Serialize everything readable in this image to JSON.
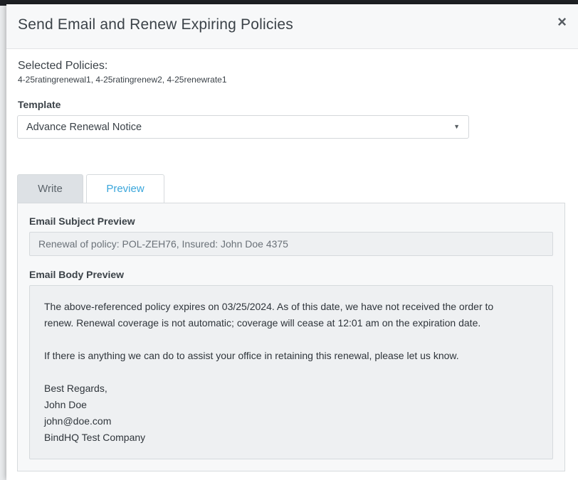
{
  "modal": {
    "title": "Send Email and Renew Expiring Policies",
    "close_label": "×"
  },
  "selected": {
    "label": "Selected Policies:",
    "values": "4-25ratingrenewal1, 4-25ratingrenew2, 4-25renewrate1"
  },
  "template": {
    "label": "Template",
    "selected_value": "Advance Renewal Notice",
    "caret": "▼"
  },
  "tabs": [
    {
      "label": "Write",
      "active": false
    },
    {
      "label": "Preview",
      "active": true
    }
  ],
  "preview": {
    "subject_label": "Email Subject Preview",
    "subject_value": "Renewal of policy: POL-ZEH76, Insured: John Doe 4375",
    "body_label": "Email Body Preview",
    "body_lines": {
      "p1_line1": "The above-referenced policy expires on 03/25/2024. As of this date, we have not received the order to",
      "p1_line2": "renew. Renewal coverage is not automatic; coverage will cease at 12:01 am on the expiration date.",
      "p2": "If there is anything we can do to assist your office in retaining this renewal, please let us know.",
      "sig1": "Best Regards,",
      "sig2": "John Doe",
      "sig3": "john@doe.com",
      "sig4": "BindHQ Test Company"
    }
  },
  "colors": {
    "accent": "#3aa6db",
    "text": "#3b4248"
  }
}
